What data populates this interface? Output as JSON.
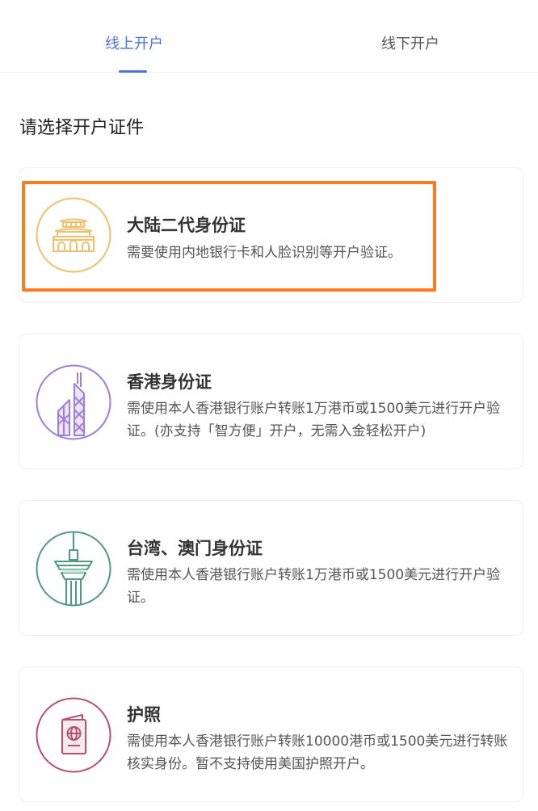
{
  "tabs": [
    {
      "label": "线上开户",
      "active": true
    },
    {
      "label": "线下开户",
      "active": false
    }
  ],
  "section_title": "请选择开户证件",
  "accent_color": "#4a72d8",
  "highlight_color": "#ff7a1a",
  "options": [
    {
      "title": "大陆二代身份证",
      "desc": "需要使用内地银行卡和人脸识别等开户验证。",
      "icon": "tiananmen-icon",
      "icon_color": "#f0c06c"
    },
    {
      "title": "香港身份证",
      "desc": "需使用本人香港银行账户转账1万港币或1500美元进行开户验证。(亦支持「智方便」开户，无需入金轻松开户)",
      "icon": "hk-tower-icon",
      "icon_color": "#9b7ee0"
    },
    {
      "title": "台湾、澳门身份证",
      "desc": "需使用本人香港银行账户转账1万港币或1500美元进行开户验证。",
      "icon": "macau-tower-icon",
      "icon_color": "#4f9a83"
    },
    {
      "title": "护照",
      "desc": "需使用本人香港银行账户转账10000港币或1500美元进行转账核实身份。暂不支持使用美国护照开户。",
      "icon": "passport-icon",
      "icon_color": "#b84f6e"
    }
  ]
}
